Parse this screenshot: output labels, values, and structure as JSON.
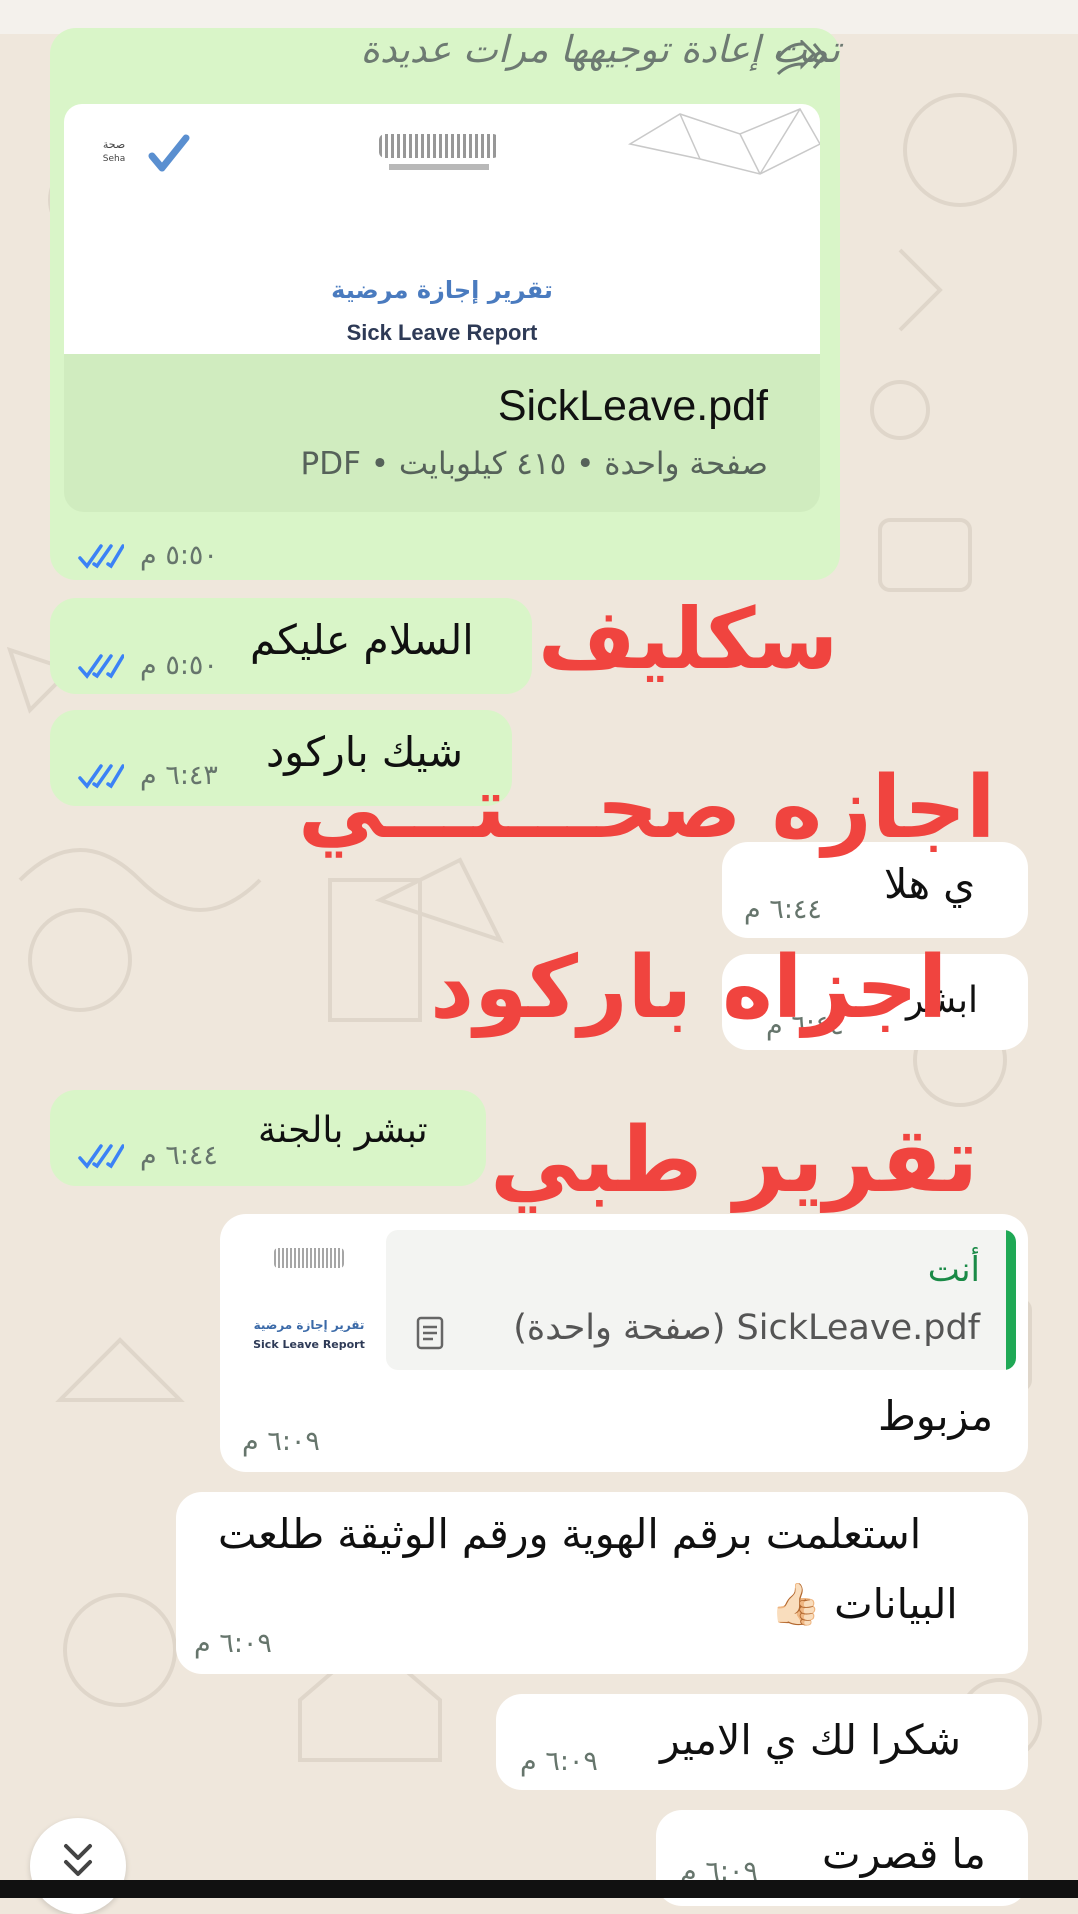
{
  "chat": {
    "forwarded_label": "تمت إعادة توجيهها مرات عديدة",
    "document": {
      "preview_brand": "صحة",
      "preview_brand_en": "Seha",
      "preview_title_ar": "تقرير إجازة مرضية",
      "preview_title_en": "Sick Leave Report",
      "file_name": "SickLeave.pdf",
      "file_meta": "صفحة واحدة • ٤١٥ كيلوبايت • PDF",
      "time": "٥:٥٠ م"
    },
    "messages": [
      {
        "text": "السلام عليكم",
        "time": "٥:٥٠ م",
        "direction": "outgoing"
      },
      {
        "text": "شيك باركود",
        "time": "٦:٤٣ م",
        "direction": "outgoing"
      },
      {
        "text": "ي هلا",
        "time": "٦:٤٤ م",
        "direction": "incoming"
      },
      {
        "text": "ابشر",
        "time": "٦:٤٤ م",
        "direction": "incoming"
      },
      {
        "text": "تبشر بالجنة",
        "time": "٦:٤٤ م",
        "direction": "outgoing"
      }
    ],
    "reply": {
      "sender": "أنت",
      "quoted_file": "SickLeave.pdf (صفحة واحدة)",
      "thumb_title_ar": "تقرير إجازة مرضية",
      "thumb_title_en": "Sick Leave Report",
      "text": "مزبوط",
      "time": "٦:٠٩ م"
    },
    "later_messages": [
      {
        "line1": "استعلمت برقم الهوية ورقم الوثيقة طلعت",
        "line2": "البيانات 👍🏻",
        "time": "٦:٠٩ م"
      },
      {
        "text": "شكرا لك ي الامير",
        "time": "٦:٠٩ م"
      },
      {
        "text": "ما قصرت",
        "time": "٦:٠٩ م"
      }
    ]
  },
  "overlay_text": {
    "line1": "سكليف",
    "line2": "اجازه صحـــتـــي",
    "line3": "اجزاه باركود",
    "line4": "تقرير طبي"
  },
  "colors": {
    "outgoing_bubble": "#d9f5c8",
    "incoming_bubble": "#ffffff",
    "read_ticks": "#3b82f6",
    "overlay_red": "#f0443f",
    "reply_bar": "#1fa855"
  },
  "icons": [
    "forward-arrows-icon",
    "read-receipt-icon",
    "document-icon",
    "scroll-down-icon",
    "check-icon"
  ]
}
